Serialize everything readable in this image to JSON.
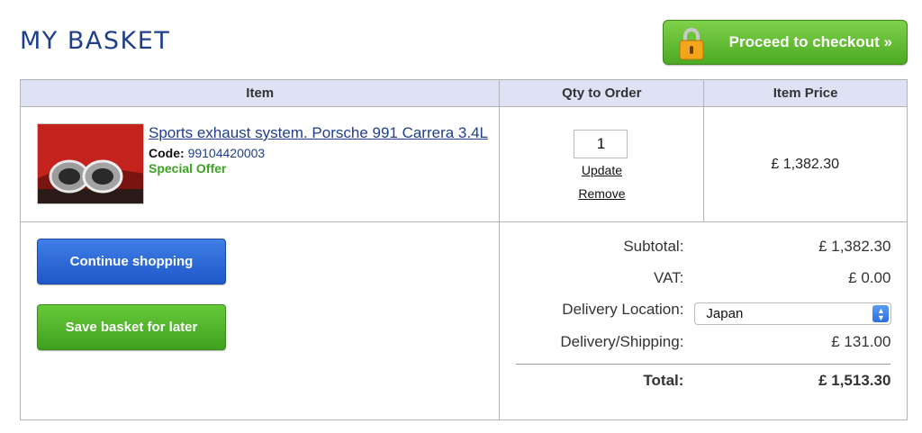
{
  "page": {
    "title": "MY BASKET"
  },
  "checkout": {
    "label": "Proceed to checkout »",
    "icon": "lock-icon"
  },
  "table": {
    "headers": {
      "item": "Item",
      "qty": "Qty to Order",
      "price": "Item Price"
    }
  },
  "item": {
    "name": "Sports exhaust system. Porsche 991 Carrera 3.4L",
    "code_label": "Code:",
    "code": "99104420003",
    "offer": "Special Offer",
    "qty": "1",
    "update_label": "Update",
    "remove_label": "Remove",
    "price": "£ 1,382.30"
  },
  "actions": {
    "continue_label": "Continue shopping",
    "save_label": "Save basket for later"
  },
  "summary": {
    "subtotal_label": "Subtotal:",
    "subtotal": "£ 1,382.30",
    "vat_label": "VAT:",
    "vat": "£ 0.00",
    "delivery_location_label": "Delivery Location:",
    "delivery_location": "Japan",
    "shipping_label": "Delivery/Shipping:",
    "shipping": "£ 131.00",
    "total_label": "Total:",
    "total": "£ 1,513.30"
  },
  "colors": {
    "title": "#1f3e8c",
    "header_bg": "#dfe1f5",
    "checkout_green": "#5cb82e",
    "continue_blue": "#2d68d6",
    "offer_green": "#3aa320"
  }
}
